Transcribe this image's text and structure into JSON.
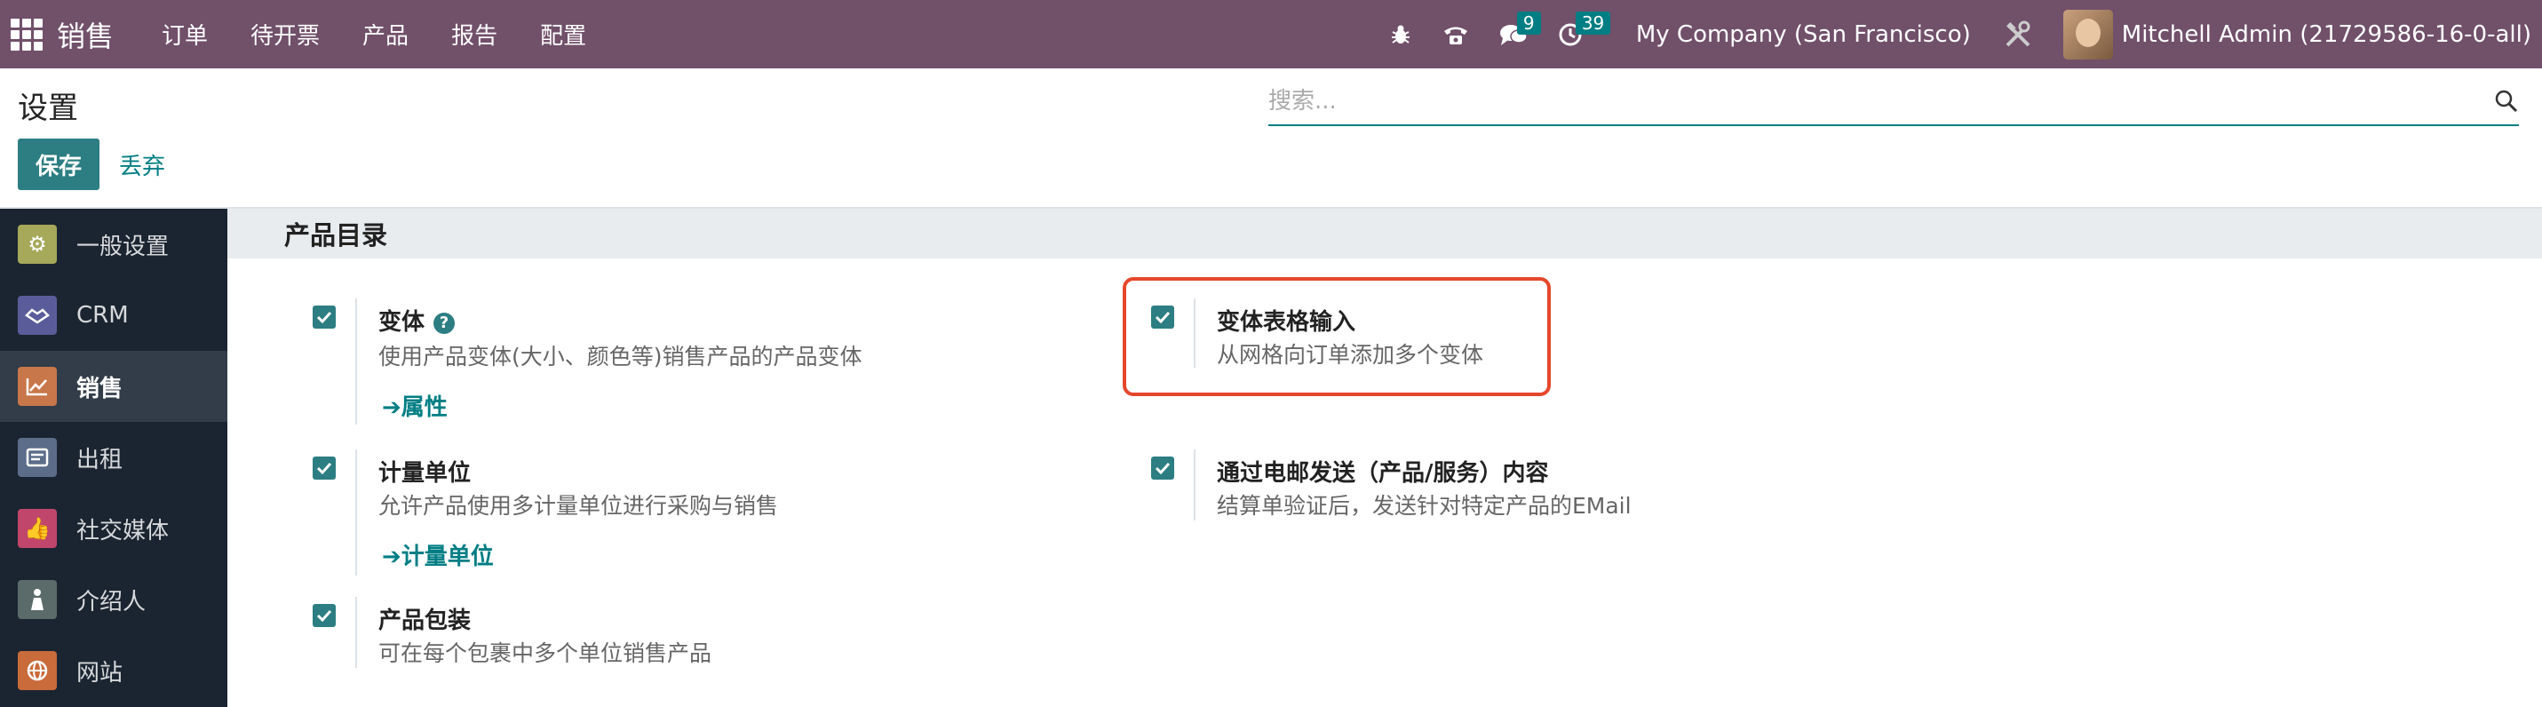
{
  "navbar": {
    "brand": "销售",
    "menu": [
      "订单",
      "待开票",
      "产品",
      "报告",
      "配置"
    ],
    "icons": [
      "bug-icon",
      "phone-icon",
      "chat-icon",
      "clock-icon",
      "tools-icon"
    ],
    "messages_badge": "9",
    "activities_badge": "39",
    "company": "My Company (San Francisco)",
    "user": "Mitchell Admin (21729586-16-0-all)"
  },
  "page": {
    "title": "设置",
    "save_label": "保存",
    "discard_label": "丢弃",
    "search_placeholder": "搜索..."
  },
  "sidebar": {
    "items": [
      {
        "label": "一般设置",
        "icon": "gear-icon",
        "color": "#a6a85a"
      },
      {
        "label": "CRM",
        "icon": "handshake-icon",
        "color": "#5a5c9a"
      },
      {
        "label": "销售",
        "icon": "chart-icon",
        "color": "#c8774a",
        "active": true
      },
      {
        "label": "出租",
        "icon": "rental-icon",
        "color": "#5b6d89"
      },
      {
        "label": "社交媒体",
        "icon": "thumbs-up-icon",
        "color": "#c0466c"
      },
      {
        "label": "介绍人",
        "icon": "referral-icon",
        "color": "#5a6b6a"
      },
      {
        "label": "网站",
        "icon": "globe-icon",
        "color": "#c96b3b"
      }
    ]
  },
  "section": {
    "title": "产品目录",
    "settings": {
      "variants": {
        "title": "变体",
        "desc": "使用产品变体(大小、颜色等)销售产品的产品变体",
        "link": "属性",
        "checked": true
      },
      "variant_grid": {
        "title": "变体表格输入",
        "desc": "从网格向订单添加多个变体",
        "checked": true
      },
      "uom": {
        "title": "计量单位",
        "desc": "允许产品使用多计量单位进行采购与销售",
        "link": "计量单位",
        "checked": true
      },
      "email_content": {
        "title": "通过电邮发送（产品/服务）内容",
        "desc": "结算单验证后，发送针对特定产品的EMail",
        "checked": true
      },
      "packaging": {
        "title": "产品包装",
        "desc": "可在每个包裹中多个单位销售产品",
        "checked": true
      }
    }
  },
  "colors": {
    "navbar": "#71506a",
    "primary": "#2c7e82",
    "link": "#017e84",
    "highlight": "#e5472b",
    "sidebar": "#1b2531"
  }
}
